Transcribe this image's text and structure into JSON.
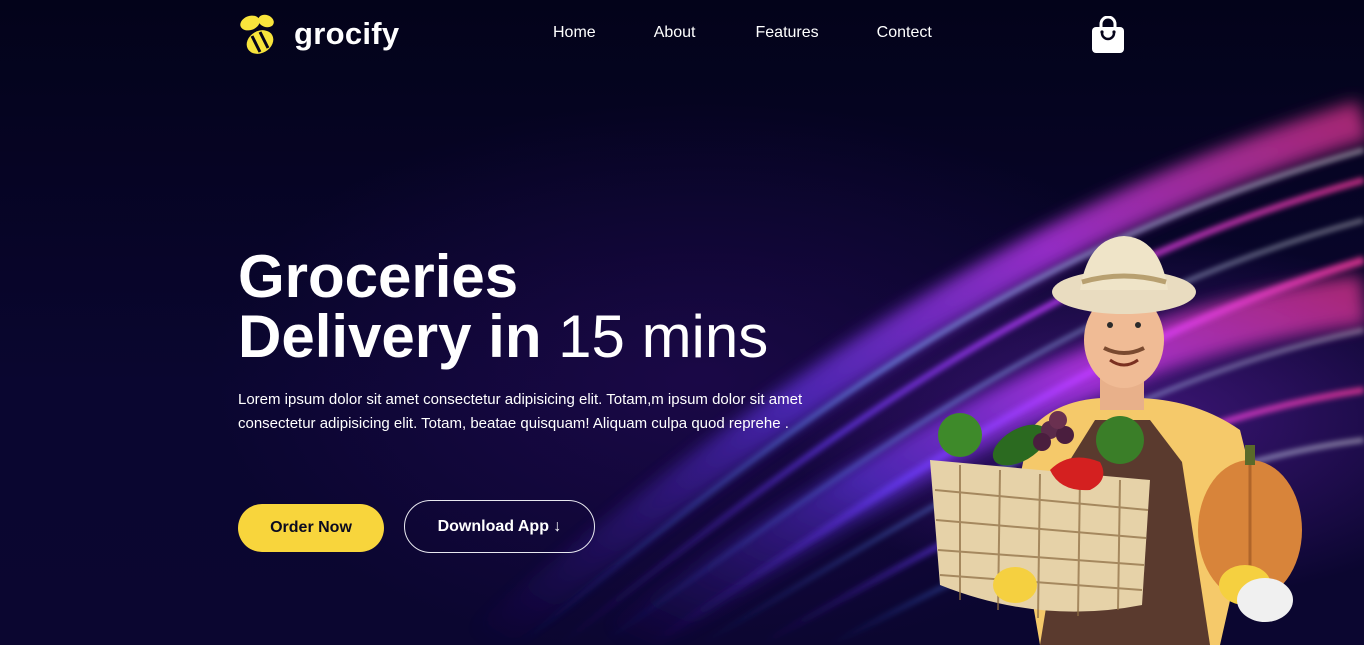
{
  "brand": {
    "name": "grocify",
    "logo_icon": "bee-icon",
    "accent": "#f8d53c"
  },
  "nav": {
    "items": [
      {
        "label": "Home"
      },
      {
        "label": "About"
      },
      {
        "label": "Features"
      },
      {
        "label": "Contect"
      }
    ],
    "cart_icon": "shopping-bag-icon"
  },
  "hero": {
    "title_line1": "Groceries",
    "title_line2_bold": "Delivery in",
    "title_line2_light": "15 mins",
    "description": "Lorem ipsum dolor sit amet consectetur adipisicing elit. Totam,m ipsum dolor sit amet consectetur adipisicing elit. Totam, beatae quisquam! Aliquam culpa quod reprehe .",
    "order_button": "Order Now",
    "download_button": "Download App ↓"
  },
  "colors": {
    "background": "#06041a",
    "text": "#ffffff",
    "button_primary": "#f8d53c"
  }
}
